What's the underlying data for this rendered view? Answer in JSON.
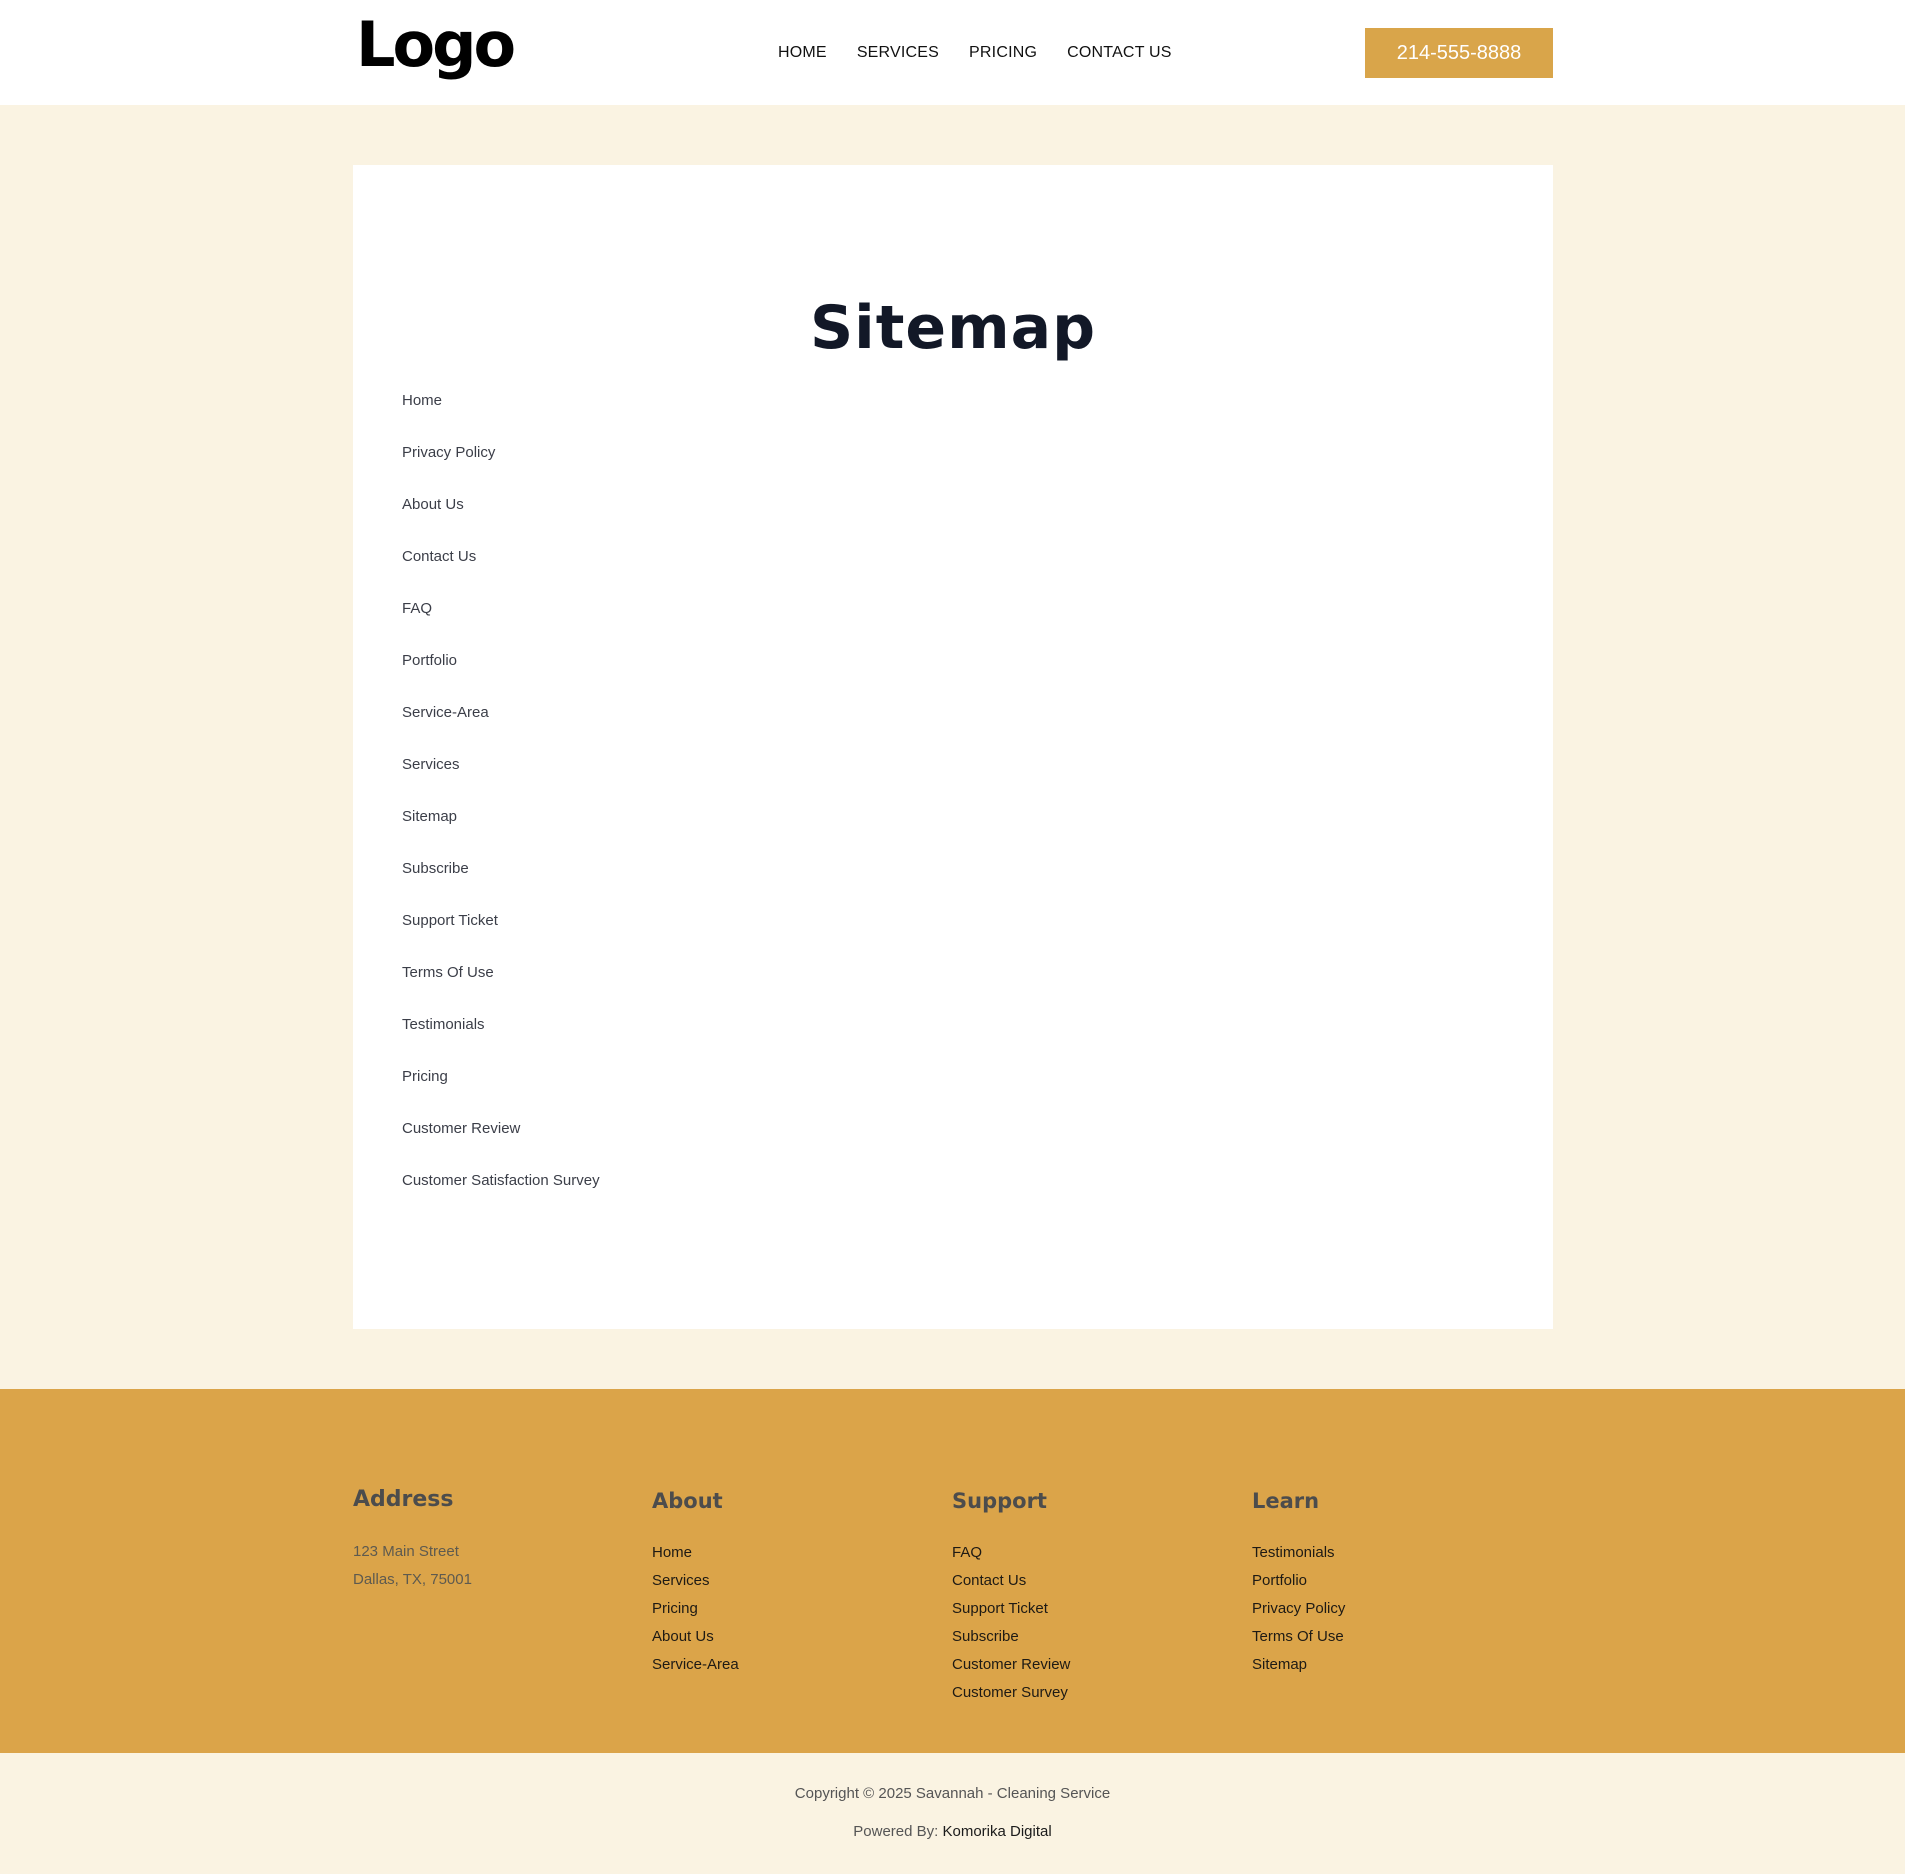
{
  "header": {
    "logo": "Logo",
    "nav": [
      "HOME",
      "SERVICES",
      "PRICING",
      "CONTACT US"
    ],
    "phone": "214-555-8888"
  },
  "main": {
    "title": "Sitemap",
    "links": [
      "Home",
      "Privacy Policy",
      "About Us",
      "Contact Us",
      "FAQ",
      "Portfolio",
      "Service-Area",
      "Services",
      "Sitemap",
      "Subscribe",
      "Support Ticket",
      "Terms Of Use",
      "Testimonials",
      "Pricing",
      "Customer Review",
      "Customer Satisfaction Survey"
    ]
  },
  "footer": {
    "address": {
      "heading": "Address",
      "line1": "123 Main Street",
      "line2": "Dallas, TX, 75001"
    },
    "about": {
      "heading": "About",
      "items": [
        "Home",
        "Services",
        "Pricing",
        "About Us",
        "Service-Area"
      ]
    },
    "support": {
      "heading": "Support",
      "items": [
        "FAQ",
        "Contact Us",
        "Support Ticket",
        "Subscribe",
        "Customer Review",
        "Customer Survey"
      ]
    },
    "learn": {
      "heading": "Learn",
      "items": [
        "Testimonials",
        "Portfolio",
        "Privacy Policy",
        "Terms Of Use",
        "Sitemap"
      ]
    }
  },
  "bottom": {
    "copyright": "Copyright © 2025 Savannah - Cleaning Service",
    "powered_label": "Powered By:",
    "powered_brand": "Komorika Digital"
  },
  "colors": {
    "accent": "#dba449",
    "background": "#faf3e2",
    "title": "#121827"
  }
}
